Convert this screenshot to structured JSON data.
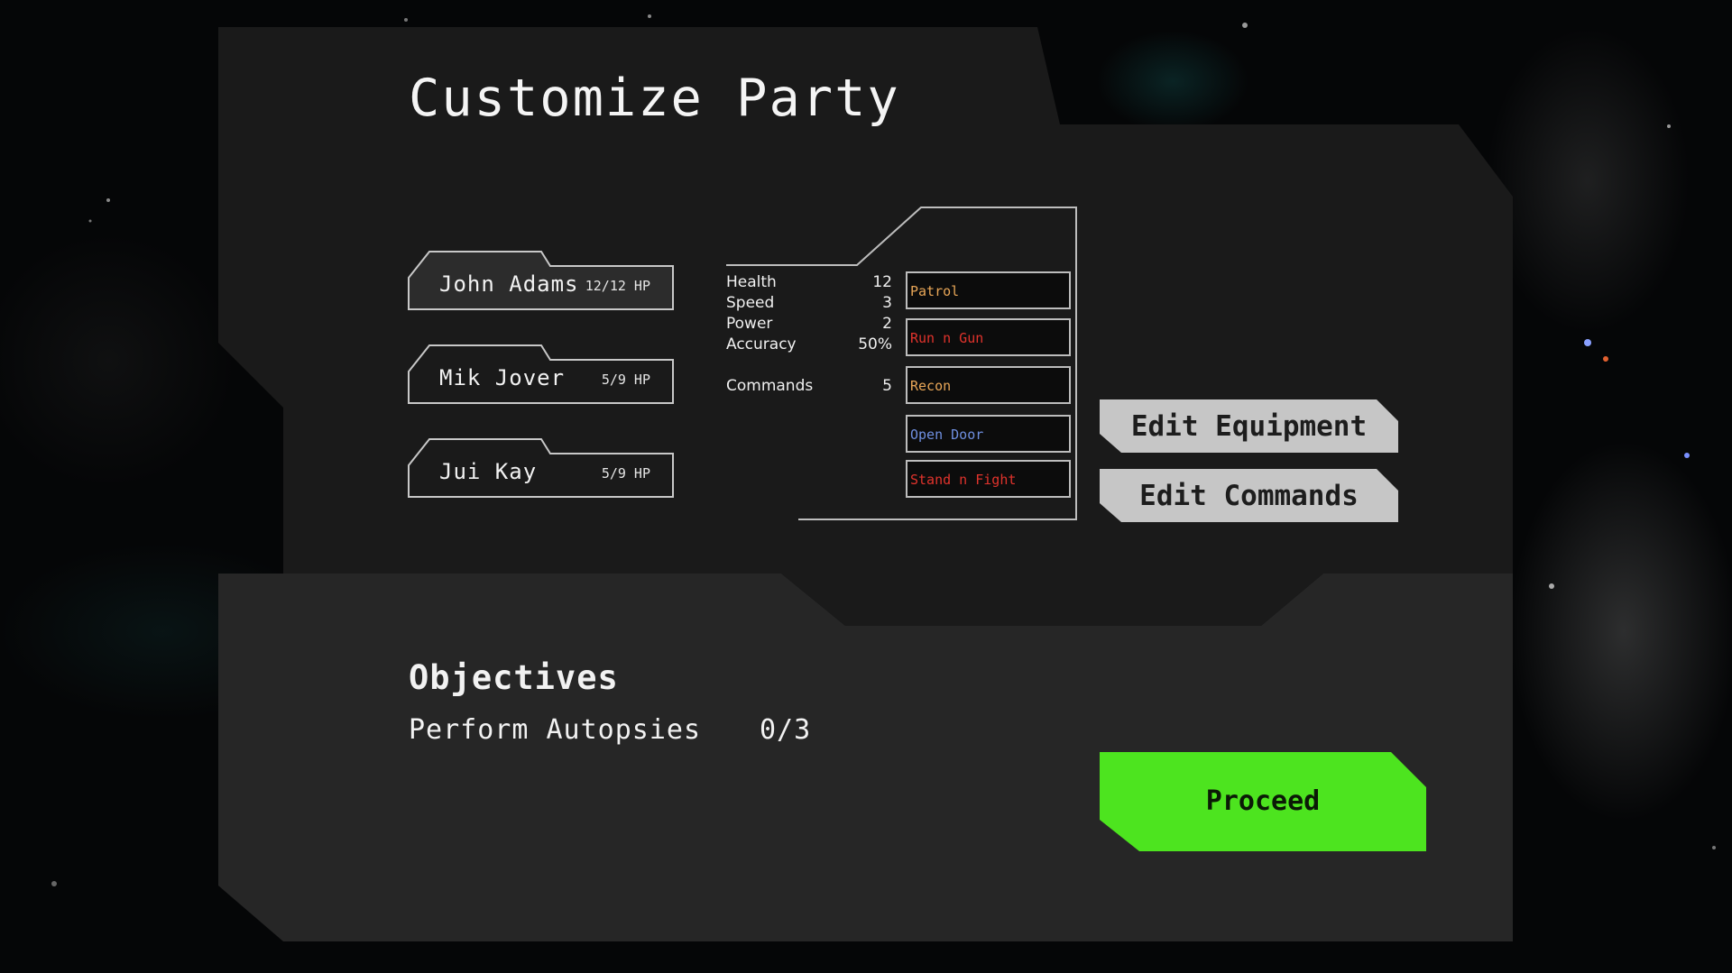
{
  "screen": {
    "title": "Customize Party"
  },
  "party": [
    {
      "name": "John Adams",
      "hp": "12/12 HP",
      "selected": true
    },
    {
      "name": "Mik Jover",
      "hp": "5/9 HP",
      "selected": false
    },
    {
      "name": "Jui Kay",
      "hp": "5/9 HP",
      "selected": false
    }
  ],
  "stats": [
    {
      "label": "Health",
      "value": "12"
    },
    {
      "label": "Speed",
      "value": "3"
    },
    {
      "label": "Power",
      "value": "2"
    },
    {
      "label": "Accuracy",
      "value": "50%"
    },
    {
      "label": "Commands",
      "value": "5"
    }
  ],
  "commands": [
    {
      "label": "Patrol",
      "color": "#e8a657"
    },
    {
      "label": "Run n Gun",
      "color": "#e0332c"
    },
    {
      "label": "Recon",
      "color": "#e8a657"
    },
    {
      "label": "Open Door",
      "color": "#6f8fe0"
    },
    {
      "label": "Stand n Fight",
      "color": "#e0332c"
    }
  ],
  "buttons": {
    "edit_equipment": "Edit Equipment",
    "edit_commands": "Edit Commands",
    "proceed": "Proceed"
  },
  "objectives": {
    "title": "Objectives",
    "items": [
      {
        "label": "Perform Autopsies",
        "progress": "0/3"
      }
    ]
  },
  "colors": {
    "panel_top": "#1a1a1a",
    "panel_bottom": "#262626",
    "proceed_green": "#4de41f",
    "button_gray": "#c6c6c6"
  }
}
